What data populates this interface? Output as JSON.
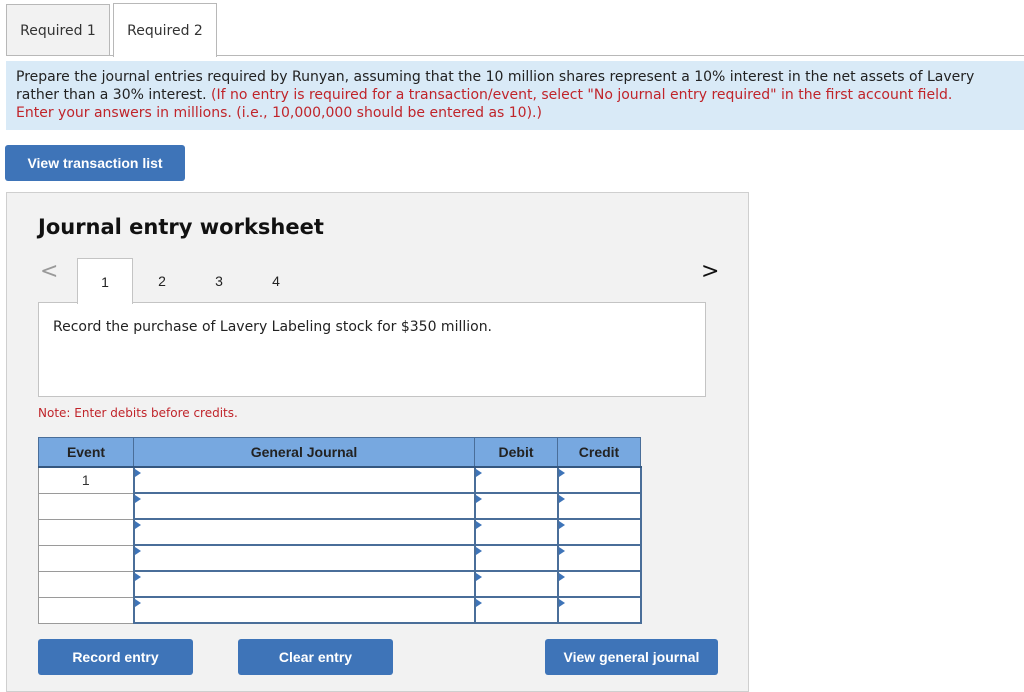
{
  "tabs": [
    {
      "label": "Required 1",
      "active": false
    },
    {
      "label": "Required 2",
      "active": true
    }
  ],
  "instruction": {
    "line1": "Prepare the journal entries required by Runyan, assuming that the 10 million shares represent a 10% interest in the net assets of Lavery",
    "line2_black": "rather than a 30% interest.",
    "line2_red": "(If no entry is required for a transaction/event, select \"No journal entry required\" in the first account field.",
    "line3_red": "Enter your answers in millions. (i.e., 10,000,000 should be entered as 10).)"
  },
  "buttons": {
    "view_transaction_list": "View transaction list",
    "record_entry": "Record entry",
    "clear_entry": "Clear entry",
    "view_general_journal": "View general journal"
  },
  "worksheet": {
    "title": "Journal entry worksheet",
    "nav_prev": "<",
    "nav_next": ">",
    "pages": [
      "1",
      "2",
      "3",
      "4"
    ],
    "active_page": "1",
    "description": "Record the purchase of Lavery Labeling stock for $350 million.",
    "note": "Note: Enter debits before credits."
  },
  "journal": {
    "headers": {
      "event": "Event",
      "account": "General Journal",
      "debit": "Debit",
      "credit": "Credit"
    },
    "rows": [
      {
        "event": "1",
        "account": "",
        "debit": "",
        "credit": ""
      },
      {
        "event": "",
        "account": "",
        "debit": "",
        "credit": ""
      },
      {
        "event": "",
        "account": "",
        "debit": "",
        "credit": ""
      },
      {
        "event": "",
        "account": "",
        "debit": "",
        "credit": ""
      },
      {
        "event": "",
        "account": "",
        "debit": "",
        "credit": ""
      },
      {
        "event": "",
        "account": "",
        "debit": "",
        "credit": ""
      }
    ]
  }
}
